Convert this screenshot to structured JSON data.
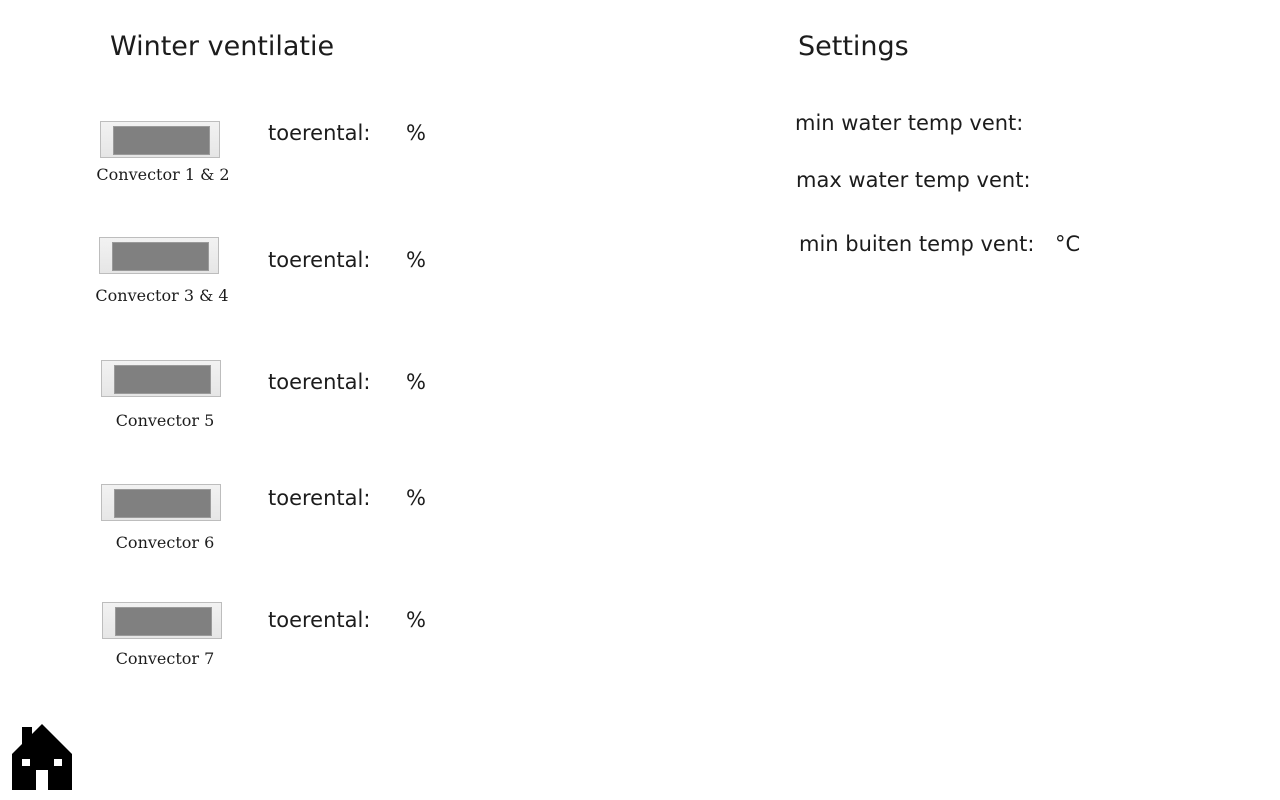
{
  "ventilation": {
    "title": "Winter ventilatie",
    "speed_label": "toerental:",
    "speed_unit": "%",
    "convectors": [
      {
        "label": "Convector 1 & 2"
      },
      {
        "label": "Convector 3 & 4"
      },
      {
        "label": "Convector 5"
      },
      {
        "label": "Convector 6"
      },
      {
        "label": "Convector 7"
      }
    ]
  },
  "settings": {
    "title": "Settings",
    "min_water_temp_label": "min water temp vent:",
    "max_water_temp_label": "max water temp vent:",
    "min_outdoor_temp_label": "min buiten temp vent:",
    "temp_unit": "°C"
  },
  "icons": {
    "home": "home-icon"
  },
  "colors": {
    "button_face": "#808080",
    "button_frame": "#e6e6e6",
    "text": "#1c1c1c",
    "background": "#ffffff"
  }
}
